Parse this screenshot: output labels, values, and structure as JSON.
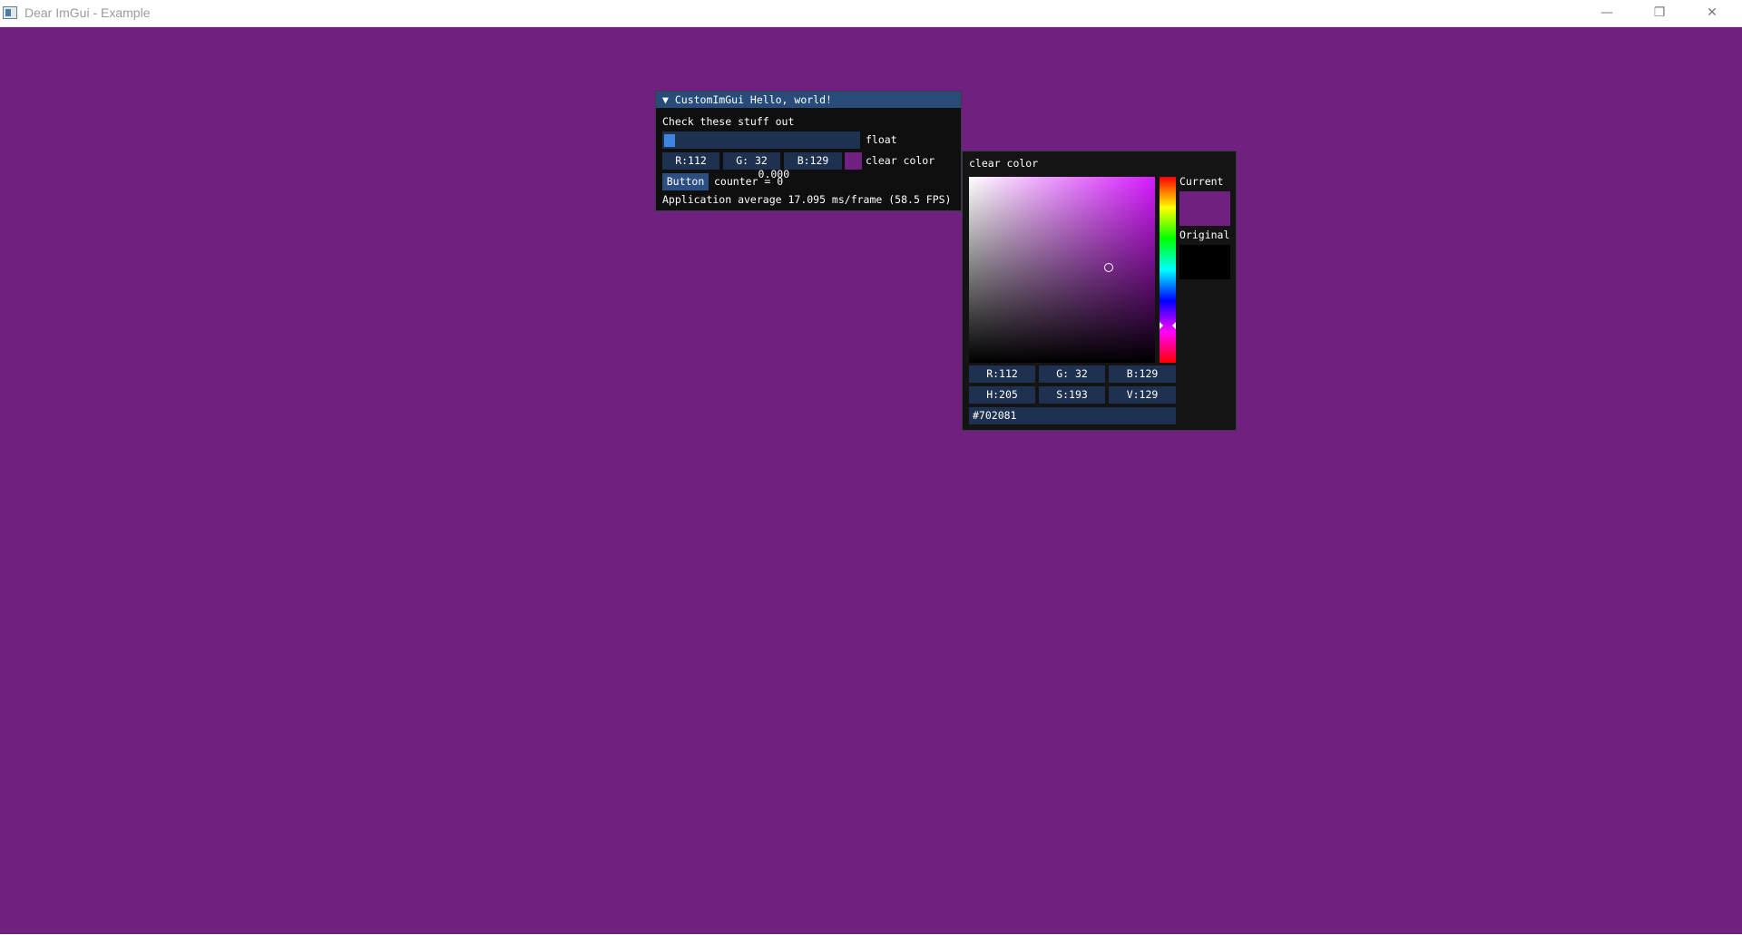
{
  "window": {
    "title": "Dear ImGui - Example",
    "minimize_glyph": "—",
    "maximize_glyph": "❐",
    "close_glyph": "✕"
  },
  "colors": {
    "background": "#702081",
    "imgui_title": "#284b7a",
    "frame": "#1e3150",
    "button": "#2c4f83"
  },
  "panel": {
    "title": "▼ CustomImGui Hello, world!",
    "text": "Check these stuff out",
    "slider_value": "0.000",
    "slider_fill_fraction": 0.0,
    "slider_label": "float",
    "color_r": "R:112",
    "color_g": "G: 32",
    "color_b": "B:129",
    "color_label": "clear color",
    "button_label": "Button",
    "counter_text": "counter = 0",
    "fps_text": "Application average 17.095 ms/frame (58.5 FPS)"
  },
  "picker": {
    "title": "clear color",
    "current_label": "Current",
    "original_label": "Original",
    "current_color": "#702081",
    "original_color": "#000000",
    "r": "R:112",
    "g": "G: 32",
    "b": "B:129",
    "h": "H:205",
    "s": "S:193",
    "v": "V:129",
    "hex": "#702081"
  }
}
